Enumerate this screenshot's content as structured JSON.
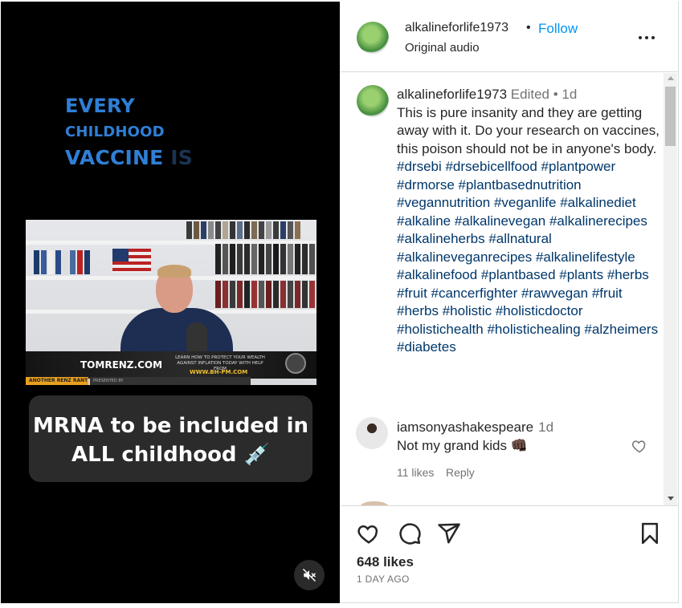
{
  "video": {
    "overlay_line1": "EVERY",
    "overlay_line2": "CHILDHOOD",
    "overlay_line3": "VACCINE",
    "overlay_line3_faint": " IS",
    "clip_brand": "TOMRENZ.COM",
    "clip_promo": "LEARN HOW TO PROTECT YOUR WEALTH AGAINST INFLATION TODAY WITH HELP FROM",
    "clip_url": "WWW.BH-PM.COM",
    "clip_tag": "ANOTHER RENZ RANT",
    "clip_subtag": "PRESENTED BY",
    "caption_line1": "MRNA to be included in",
    "caption_line2": "ALL childhood 💉",
    "mute_icon": "speaker-muted-icon"
  },
  "header": {
    "username": "alkalineforlife1973",
    "separator": "•",
    "follow_label": "Follow",
    "audio_label": "Original audio"
  },
  "post_caption": {
    "username": "alkalineforlife1973",
    "edited": "Edited",
    "dot": "•",
    "age": "1d",
    "text": "This is pure insanity and they are getting away with it. Do your research on vaccines, this poison should not be in anyone's body.",
    "hashtags": "#drsebi #drsebicellfood #plantpower #drmorse #plantbasednutrition #vegannutrition #veganlife #alkalinediet #alkaline #alkalinevegan #alkalinerecipes #alkalineherbs #allnatural #alkalineveganrecipes #alkalinelifestyle #alkalinefood #plantbased #plants #herbs #fruit #cancerfighter #rawvegan #fruit #herbs #holistic #holisticdoctor #holistichealth #holistichealing #alzheimers #diabetes"
  },
  "comment": {
    "username": "iamsonyashakespeare",
    "age": "1d",
    "text": "Not my grand kids 👊🏿",
    "likes": "11 likes",
    "reply_label": "Reply"
  },
  "footer": {
    "likes": "648 likes",
    "date": "1 DAY AGO"
  },
  "colors": {
    "accent": "#0095f6",
    "hashtag": "#00376b",
    "muted_text": "#737373",
    "overlay_blue": "#2f7fd6"
  }
}
